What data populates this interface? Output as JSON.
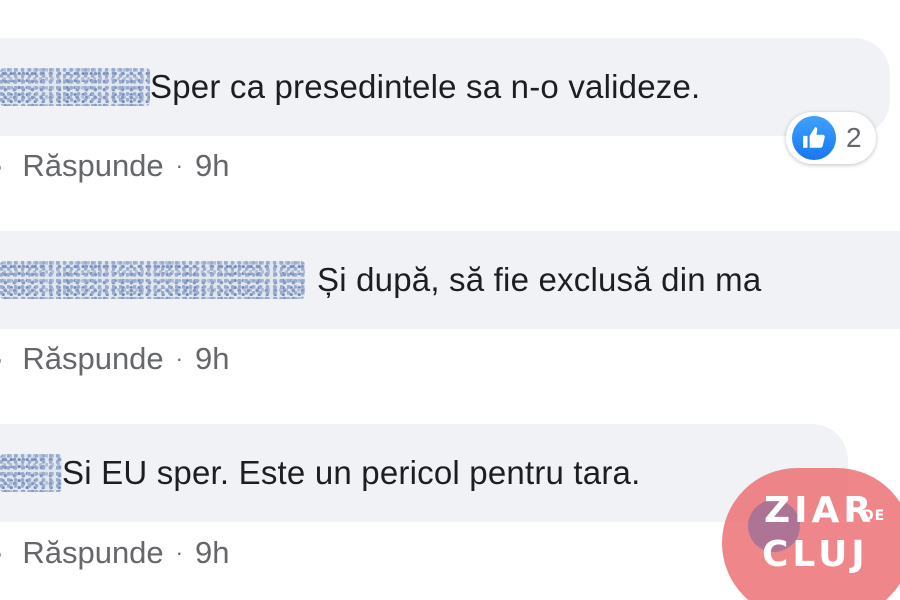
{
  "comments": [
    {
      "text": "Sper ca presedintele sa n-o valideze.",
      "reply_label": "Răspunde",
      "time": "9h",
      "reaction_count": "2"
    },
    {
      "text": "Și după, să fie exclusă din ma",
      "reply_label": "Răspunde",
      "time": "9h"
    },
    {
      "text": "Si EU sper. Este un pericol pentru tara.",
      "reply_label": "Răspunde",
      "time": "9h"
    }
  ],
  "lead_dot": "·",
  "separator": "·",
  "logo": {
    "line1": "ZIAR",
    "de": "DE",
    "line2": "CLUJ",
    "color": "#ec6c70"
  },
  "colors": {
    "bubble": "#f0f2f5",
    "meta_text": "#65676b",
    "like_blue": "#1877f2"
  }
}
